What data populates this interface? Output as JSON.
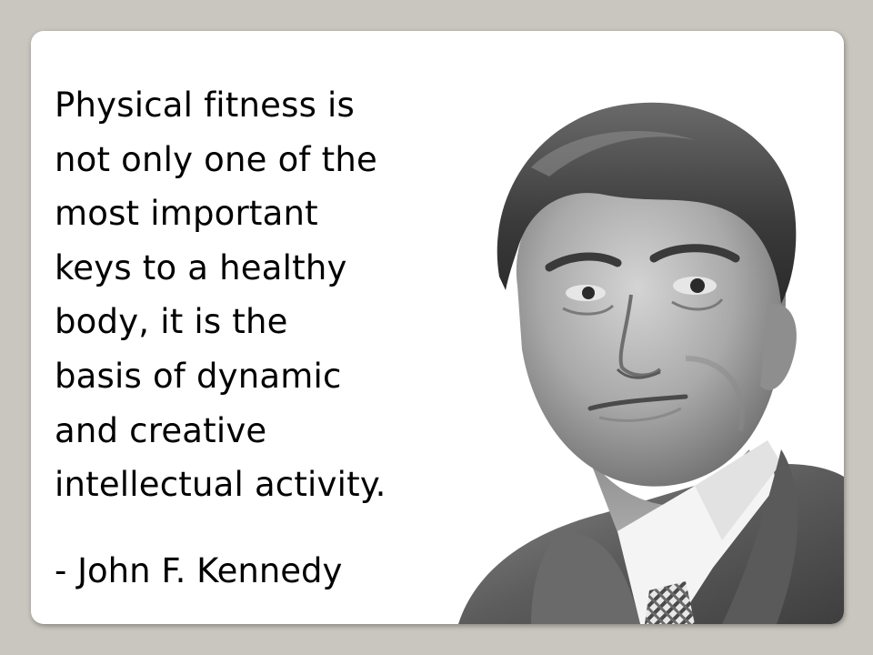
{
  "quote": {
    "lines": [
      "Physical fitness is",
      "not only one of the",
      "most important",
      "keys to a healthy",
      "body, it is the",
      "basis of dynamic",
      "and creative",
      "intellectual activity."
    ],
    "attribution": "- John F. Kennedy"
  },
  "colors": {
    "background": "#c9c6bf",
    "card": "#ffffff",
    "text": "#000000"
  },
  "portrait": {
    "style": "black-and-white photo"
  }
}
